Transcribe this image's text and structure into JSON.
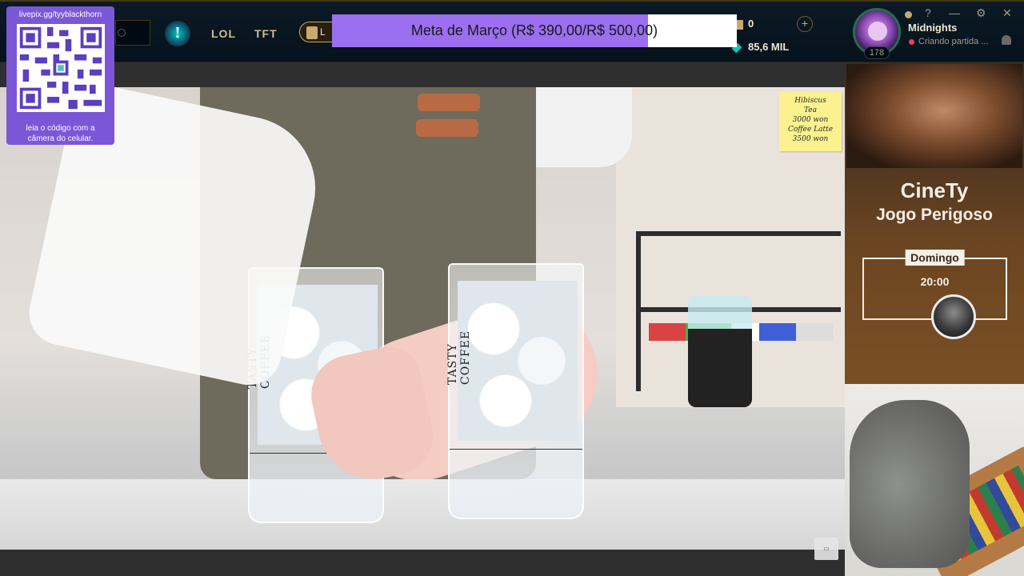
{
  "top_nav": {
    "items": [
      "LOL",
      "TFT"
    ],
    "play_label": "L"
  },
  "qr_overlay": {
    "url": "livepix.gg/tyyblackthorn",
    "caption_line1": "leia o código com a",
    "caption_line2": "câmera do celular."
  },
  "donation_goal": {
    "text": "Meta de Março (R$ 390,00/R$ 500,00)",
    "current": 390,
    "target": 500,
    "progress_fraction": 0.78,
    "fill_color": "#9b6ff0"
  },
  "currency": {
    "rp_value": "0",
    "blue_essence_value": "85,6 MIL"
  },
  "profile": {
    "name": "Midnights",
    "status": "Criando partida ...",
    "level": "178"
  },
  "window_controls": {
    "help": "?",
    "minimize": "—",
    "settings": "⚙",
    "close": "✕"
  },
  "video": {
    "cup_brand": "TASTY COFFEE",
    "sticky_note": [
      "Hibiscus",
      "Tea",
      "3000 won",
      "Coffee Latte",
      "3500 won"
    ]
  },
  "poster": {
    "title": "CineTy",
    "subtitle": "Jogo Perigoso",
    "day": "Domingo",
    "time": "20:00"
  }
}
